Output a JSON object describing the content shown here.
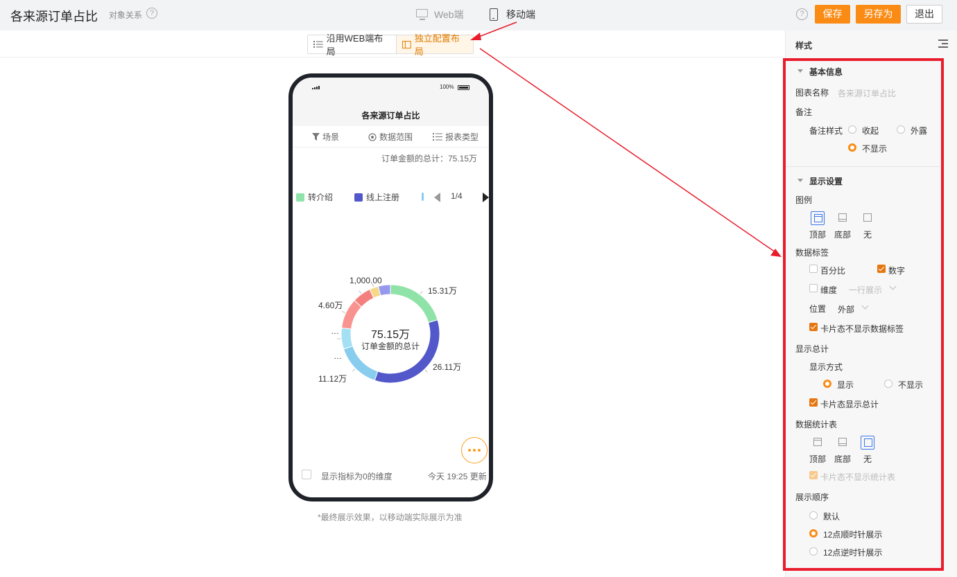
{
  "header": {
    "title": "各来源订单占比",
    "object_relation": "对象关系",
    "help": "?",
    "tab_web": "Web端",
    "tab_mobile": "移动端",
    "save": "保存",
    "save_as": "另存为",
    "exit": "退出"
  },
  "layout_switch": {
    "web_layout": "沿用WEB端布局",
    "independent_layout": "独立配置布局"
  },
  "phone": {
    "battery": "100%",
    "chart_title": "各来源订单占比",
    "filters": [
      "场景",
      "数据范围",
      "报表类型"
    ],
    "total_label": "订单金额的总计：75.15万",
    "legend": [
      "转介绍",
      "线上注册"
    ],
    "pager": "1/4",
    "center_value": "75.15万",
    "center_label": "订单金额的总计",
    "show_zero_label": "显示指标为0的维度",
    "update_time": "今天 19:25 更新"
  },
  "chart_data": {
    "type": "pie",
    "total": "75.15万",
    "slices": [
      {
        "label": "转介绍",
        "display": "15.31万",
        "value": 153100,
        "color": "#8fe3a8"
      },
      {
        "label": "线上注册",
        "display": "26.11万",
        "value": 261100,
        "color": "#5257c9"
      },
      {
        "label": "",
        "display": "11.12万",
        "value": 111200,
        "color": "#88cdee"
      },
      {
        "label": "",
        "display": "…",
        "value": 52000,
        "color": "#a3e0f4"
      },
      {
        "label": "",
        "display": "…",
        "value": 75000,
        "color": "#f89390"
      },
      {
        "label": "",
        "display": "4.60万",
        "value": 46000,
        "color": "#f47f7f"
      },
      {
        "label": "",
        "display": "1,000.00",
        "value": 22000,
        "color": "#f6d889"
      },
      {
        "label": "",
        "display": "",
        "value": 30000,
        "color": "#9698ef"
      }
    ],
    "colors": [
      "#8fe3a8",
      "#5257c9",
      "#88cdee",
      "#a3e0f4",
      "#f89390",
      "#f47f7f",
      "#f6d889",
      "#9698ef"
    ]
  },
  "canvas_note": "*最终展示效果，以移动端实际展示为准",
  "panel": {
    "title": "样式",
    "basic_info": "基本信息",
    "chart_name_label": "图表名称",
    "chart_name_value": "各来源订单占比",
    "remark": "备注",
    "remark_style": "备注样式",
    "remark_collapse": "收起",
    "remark_expose": "外露",
    "remark_hide": "不显示",
    "display_settings": "显示设置",
    "legend": "图例",
    "legend_top": "顶部",
    "legend_bottom": "底部",
    "legend_none": "无",
    "data_labels": "数据标签",
    "percent": "百分比",
    "number": "数字",
    "dimension": "维度",
    "dimension_mode": "一行展示",
    "position": "位置",
    "position_value": "外部",
    "card_hide_labels": "卡片态不显示数据标签",
    "show_total": "显示总计",
    "show_mode": "显示方式",
    "show": "显示",
    "no_show": "不显示",
    "card_show_total": "卡片态显示总计",
    "stat_table": "数据统计表",
    "stat_top": "顶部",
    "stat_bottom": "底部",
    "stat_none": "无",
    "card_hide_stat": "卡片态不显示统计表",
    "order": "展示顺序",
    "order_default": "默认",
    "order_cw": "12点顺时针展示",
    "order_ccw": "12点逆时针展示"
  },
  "accent": "#fa8c16",
  "highlight": "#e81c2b"
}
